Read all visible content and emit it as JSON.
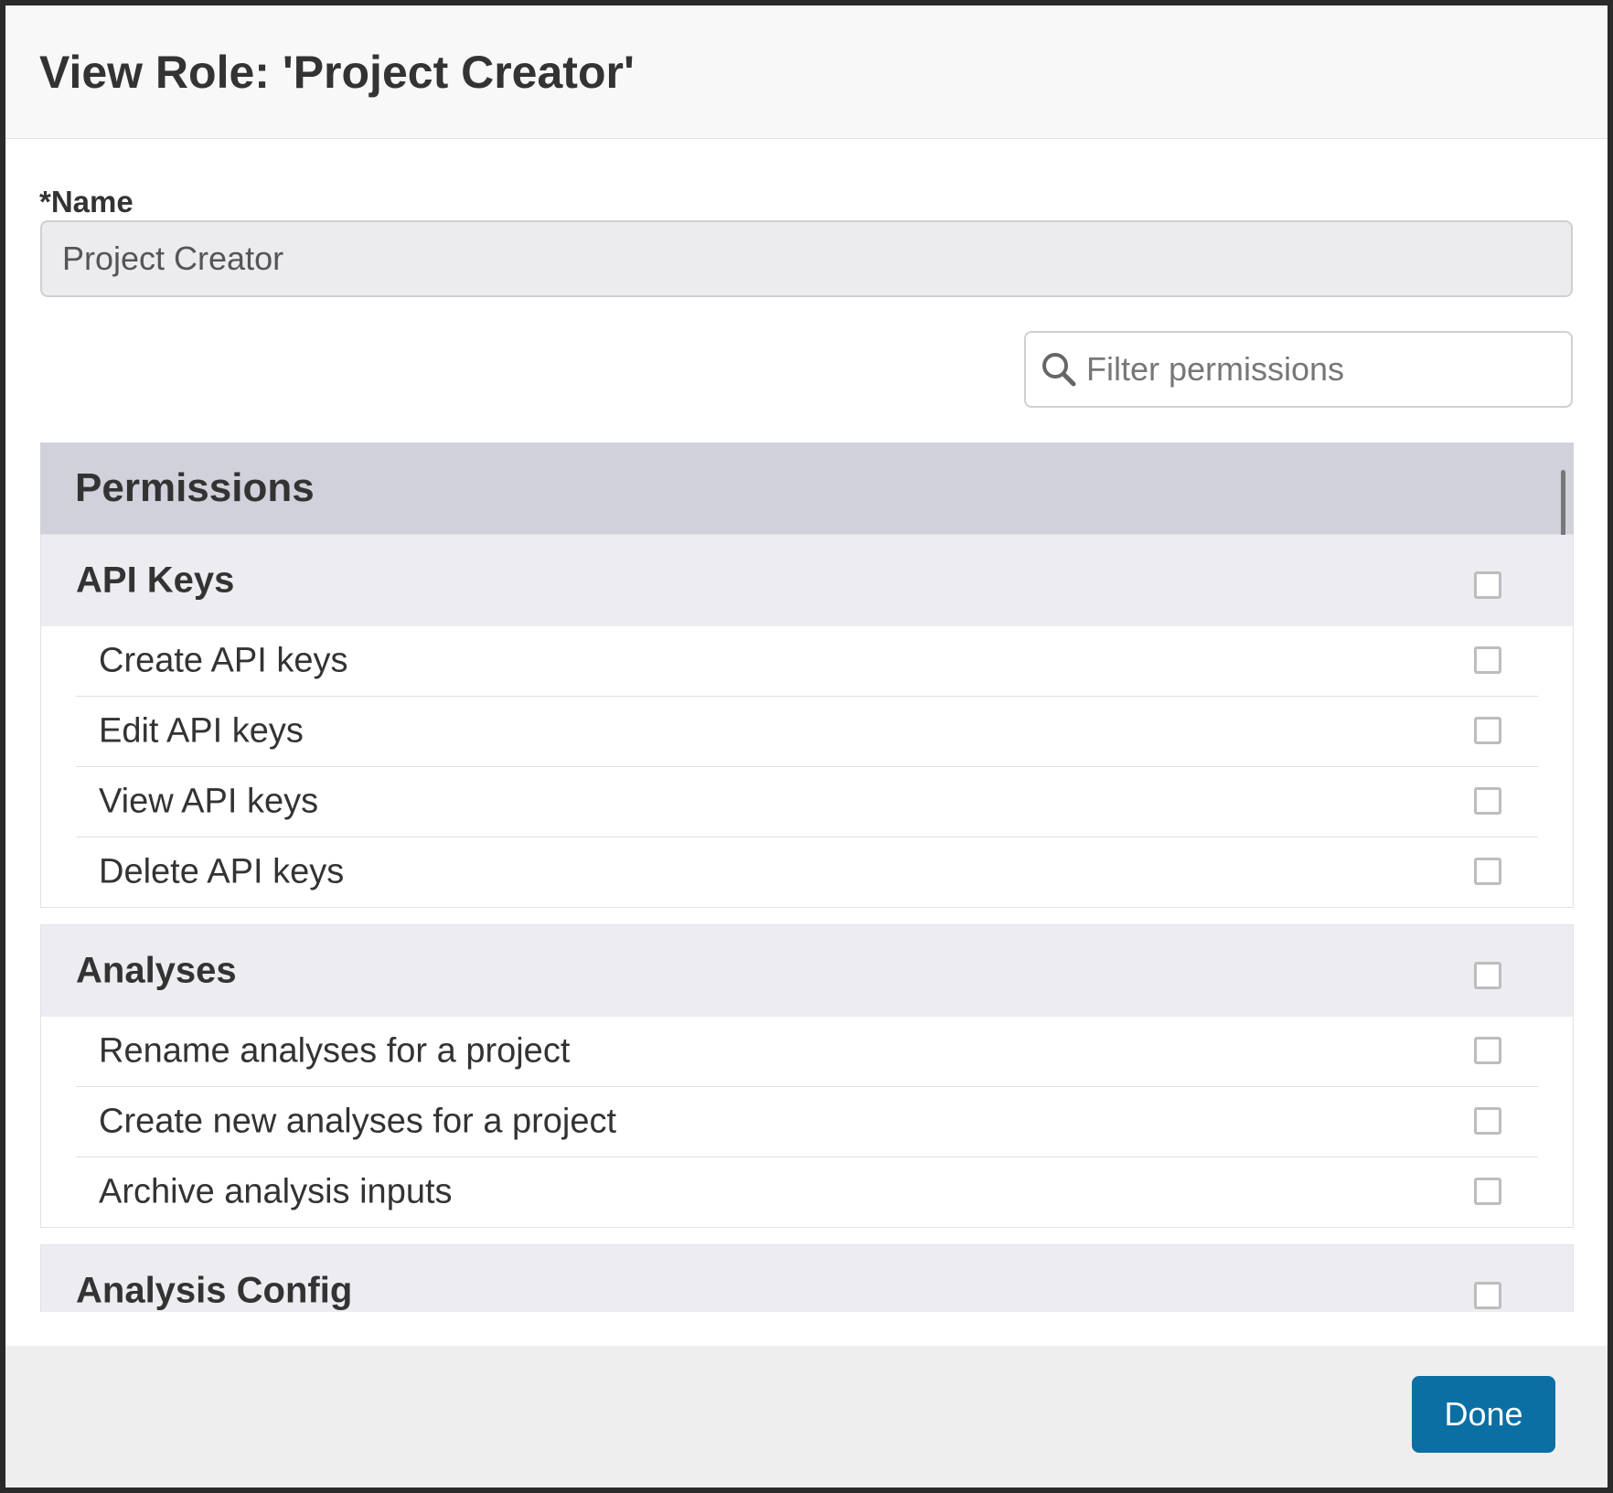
{
  "dialog": {
    "title": "View Role: 'Project Creator'"
  },
  "name_field": {
    "label": "*Name",
    "value": "Project Creator"
  },
  "filter": {
    "placeholder": "Filter permissions",
    "icon": "search-icon"
  },
  "permissions": {
    "header": "Permissions",
    "groups": [
      {
        "title": "API Keys",
        "checked": false,
        "items": [
          {
            "label": "Create API keys",
            "checked": false
          },
          {
            "label": "Edit API keys",
            "checked": false
          },
          {
            "label": "View API keys",
            "checked": false
          },
          {
            "label": "Delete API keys",
            "checked": false
          }
        ]
      },
      {
        "title": "Analyses",
        "checked": false,
        "items": [
          {
            "label": "Rename analyses for a project",
            "checked": false
          },
          {
            "label": "Create new analyses for a project",
            "checked": false
          },
          {
            "label": "Archive analysis inputs",
            "checked": false
          }
        ]
      },
      {
        "title": "Analysis Config",
        "checked": false,
        "items": []
      }
    ]
  },
  "footer": {
    "done_label": "Done"
  },
  "colors": {
    "primary_button": "#0b6fa4",
    "permissions_header_bg": "#d1d1dc",
    "group_header_bg": "#ededf1"
  }
}
